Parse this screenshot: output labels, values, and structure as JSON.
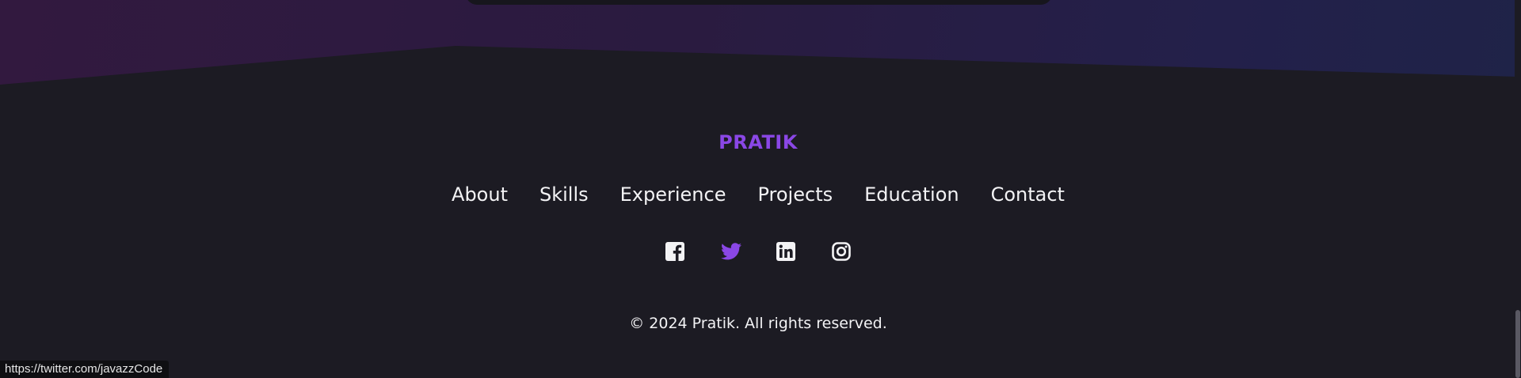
{
  "brand": {
    "name": "PRATIK",
    "color": "#8a47e6"
  },
  "nav": {
    "items": [
      {
        "label": "About"
      },
      {
        "label": "Skills"
      },
      {
        "label": "Experience"
      },
      {
        "label": "Projects"
      },
      {
        "label": "Education"
      },
      {
        "label": "Contact"
      }
    ]
  },
  "socials": [
    {
      "icon": "facebook-icon",
      "color": "#f3f3f5"
    },
    {
      "icon": "twitter-icon",
      "color": "#8a47e6"
    },
    {
      "icon": "linkedin-icon",
      "color": "#f3f3f5"
    },
    {
      "icon": "instagram-icon",
      "color": "#f3f3f5"
    }
  ],
  "footer": {
    "copyright": "© 2024 Pratik. All rights reserved."
  },
  "status_bar": {
    "url": "https://twitter.com/javazzCode"
  }
}
